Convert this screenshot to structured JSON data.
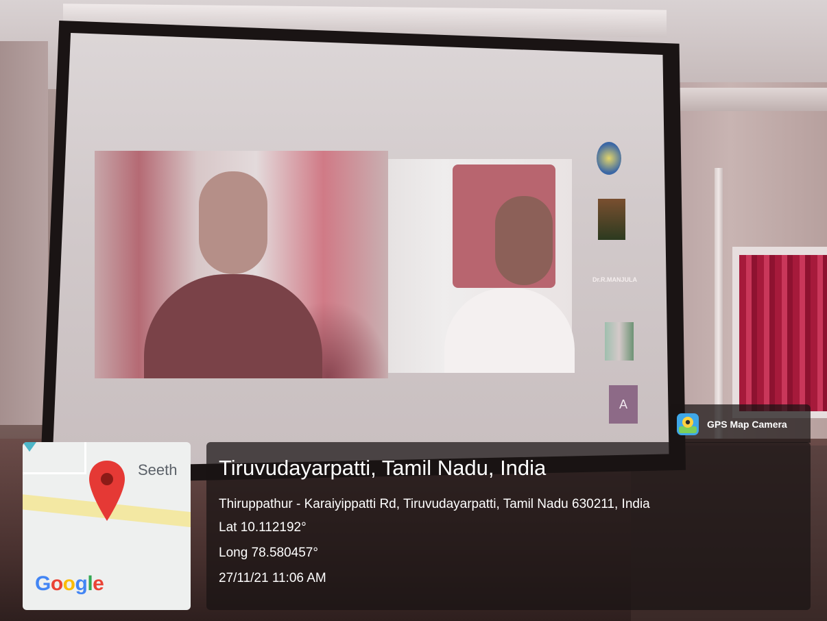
{
  "location": {
    "title": "Tiruvudayarpatti, Tamil Nadu, India",
    "address": "Thiruppathur - Karaiyippatti Rd, Tiruvudayarpatti, Tamil Nadu 630211, India",
    "lat": "Lat 10.112192°",
    "long": "Long 78.580457°",
    "datetime": "27/11/21 11:06 AM"
  },
  "map": {
    "street_label": "Seeth",
    "brand": [
      "G",
      "o",
      "o",
      "g",
      "l",
      "e"
    ],
    "pin_color": "#E53935"
  },
  "badge": {
    "label": "GPS Map Camera"
  },
  "projection": {
    "participant_name": "Dr.R.MANJULA",
    "avatar_letter": "A"
  }
}
